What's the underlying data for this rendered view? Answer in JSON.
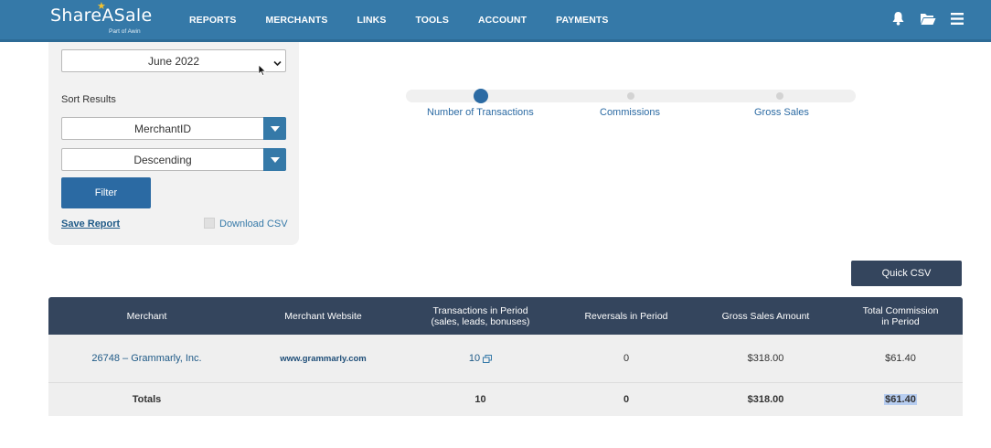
{
  "header": {
    "logo_text": "ShareASale",
    "logo_subtext": "Part of Awin",
    "nav": [
      "REPORTS",
      "MERCHANTS",
      "LINKS",
      "TOOLS",
      "ACCOUNT",
      "PAYMENTS"
    ],
    "icons": [
      "bell-icon",
      "folder-icon",
      "menu-icon"
    ]
  },
  "filters": {
    "month_value": "June 2022",
    "sort_label": "Sort Results",
    "sort_by_value": "MerchantID",
    "sort_order_value": "Descending",
    "filter_button": "Filter",
    "save_report": "Save Report",
    "download_csv": "Download CSV"
  },
  "stepper": {
    "steps": [
      "Number of Transactions",
      "Commissions",
      "Gross Sales"
    ],
    "active_index": 0
  },
  "quick_csv": "Quick CSV",
  "table": {
    "headers": [
      "Merchant",
      "Merchant Website",
      "Transactions in Period\n(sales, leads, bonuses)",
      "Reversals in Period",
      "Gross Sales Amount",
      "Total Commission\nin Period"
    ],
    "rows": [
      {
        "merchant": "26748 – Grammarly, Inc.",
        "website": "www.grammarly.com",
        "transactions": "10",
        "reversals": "0",
        "gross_sales": "$318.00",
        "commission": "$61.40"
      }
    ],
    "totals": {
      "label": "Totals",
      "transactions": "10",
      "reversals": "0",
      "gross_sales": "$318.00",
      "commission": "$61.40"
    }
  },
  "colors": {
    "header_bg": "#3579a8",
    "table_header_bg": "#34455d",
    "accent": "#2b6aa3"
  }
}
